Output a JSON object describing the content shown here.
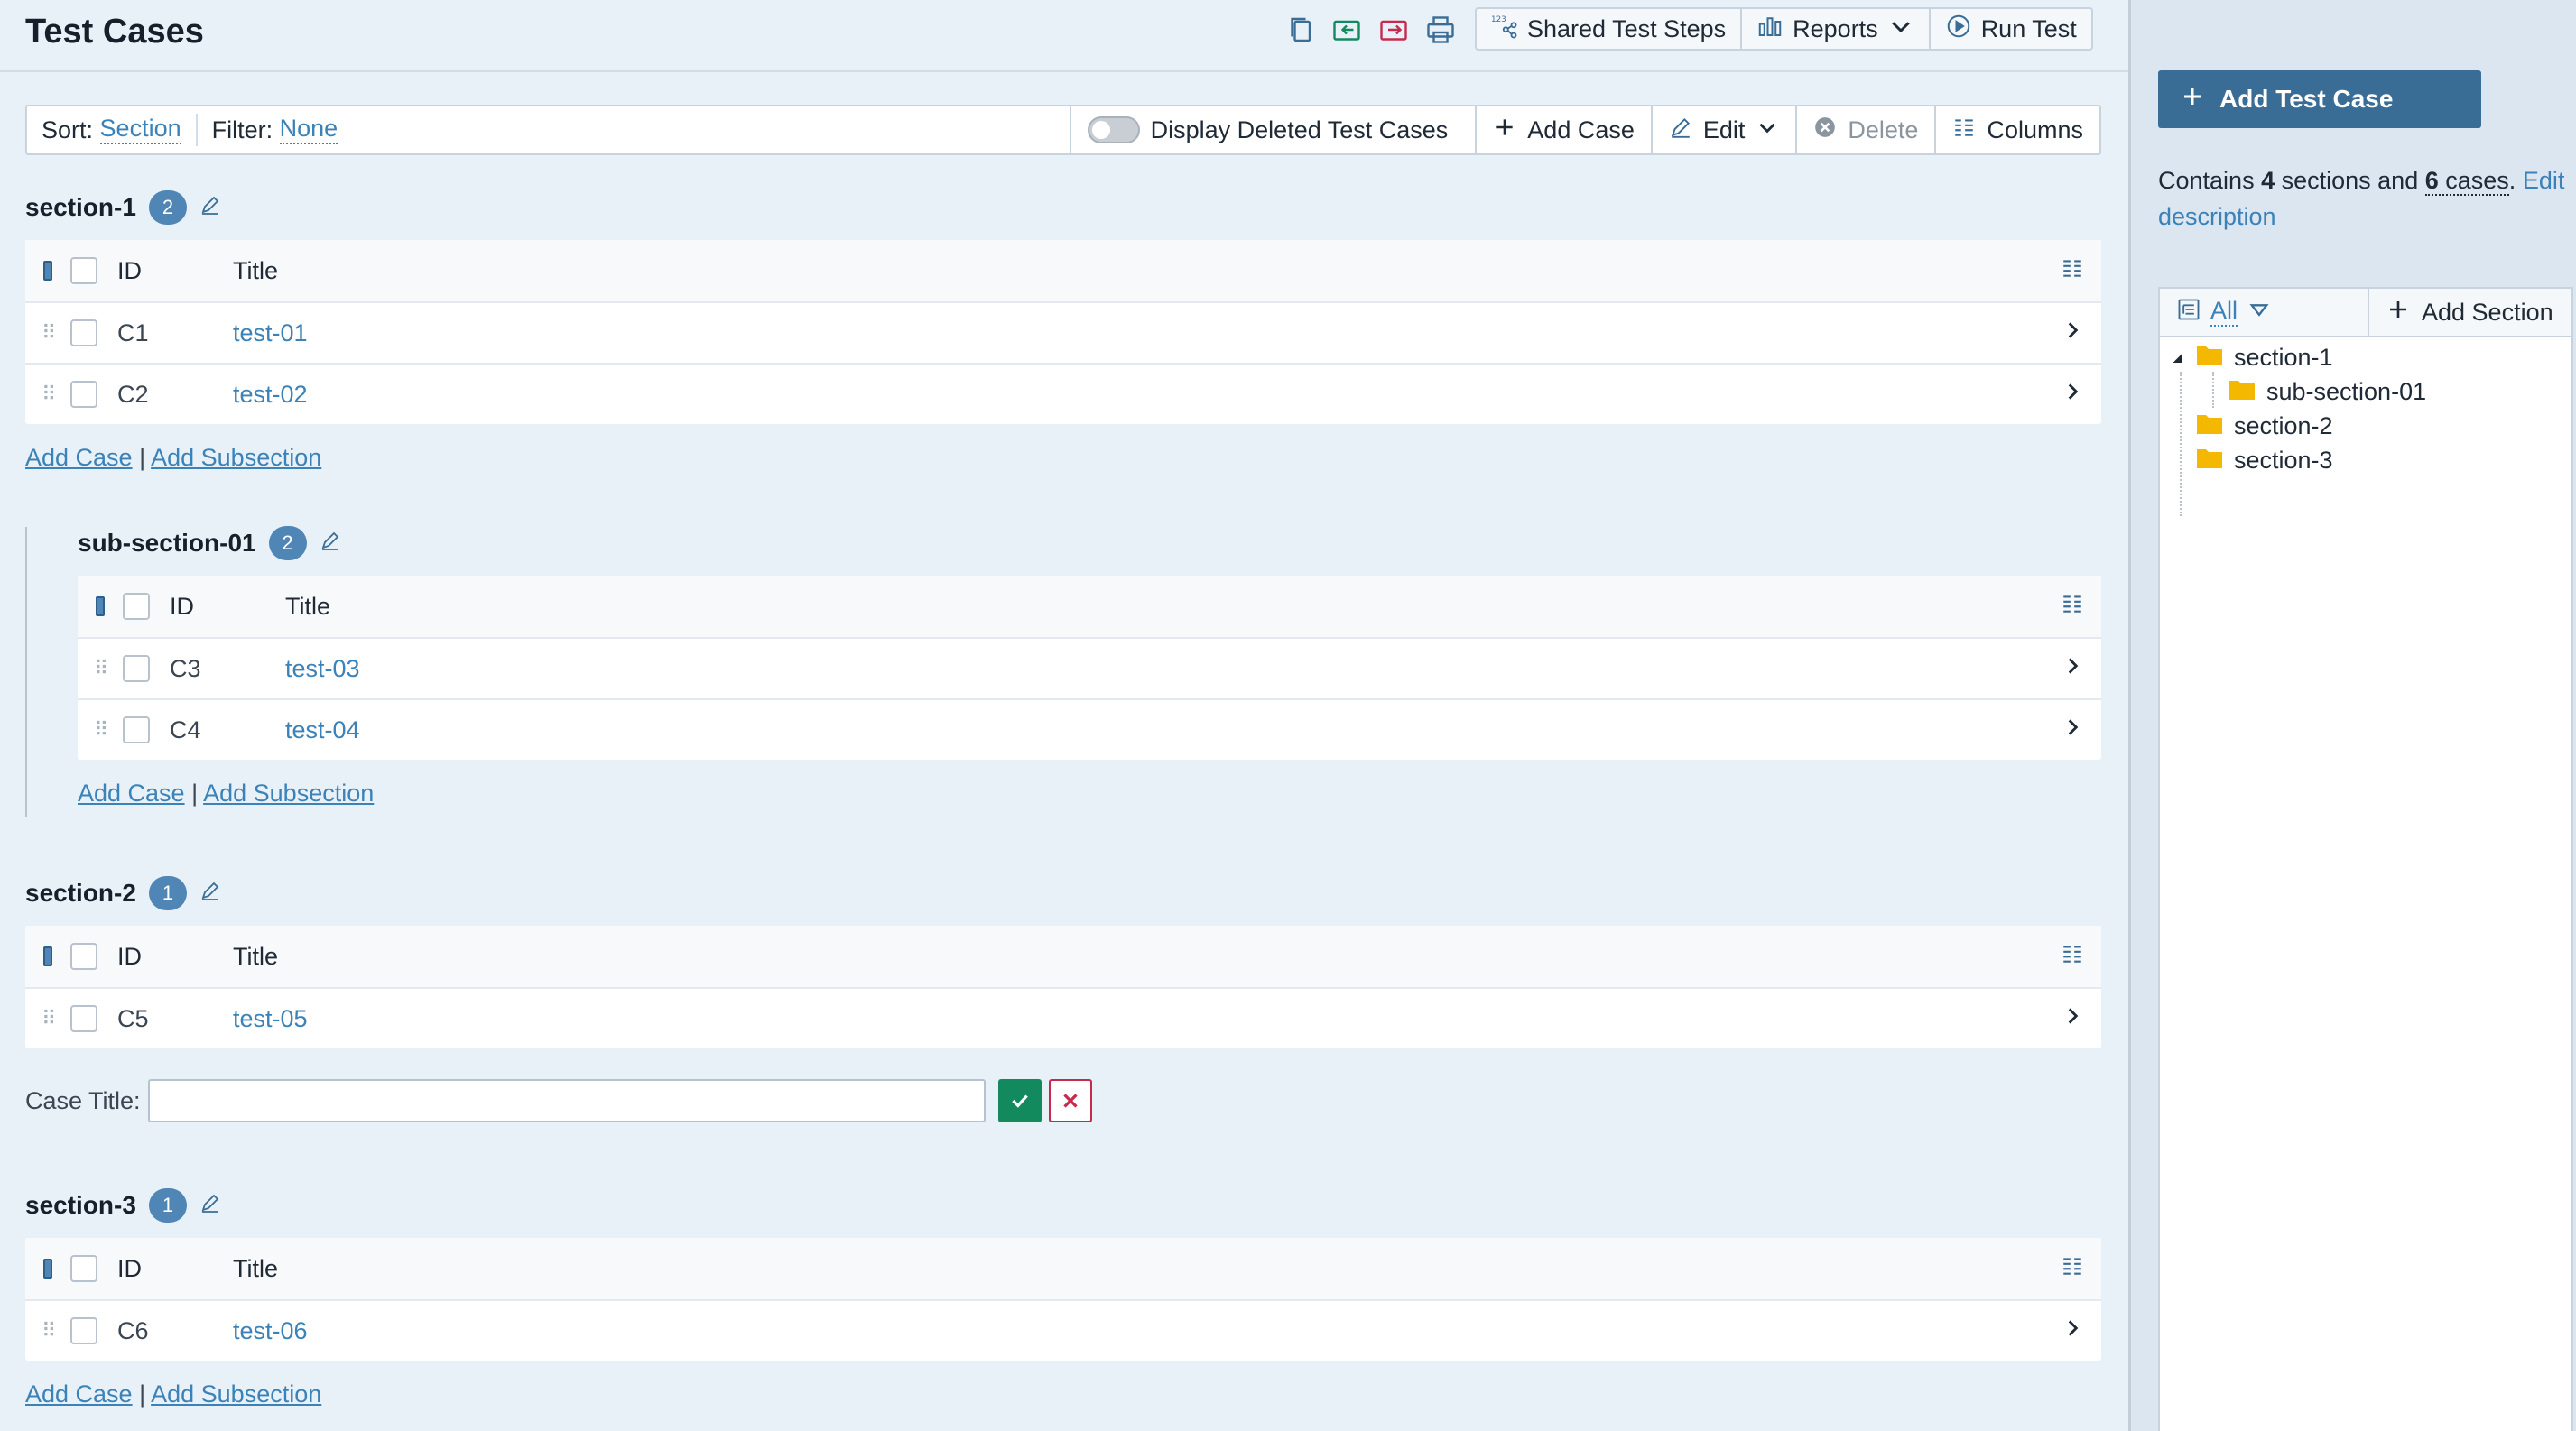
{
  "header": {
    "title": "Test Cases",
    "buttons": {
      "shared_steps": "Shared Test Steps",
      "reports": "Reports",
      "run_test": "Run Test"
    },
    "icons": [
      "copy-icon",
      "import-icon",
      "export-icon",
      "print-icon"
    ]
  },
  "toolbar": {
    "sort_label": "Sort:",
    "sort_value": "Section",
    "filter_label": "Filter:",
    "filter_value": "None",
    "display_deleted": "Display Deleted Test Cases",
    "add_case": "Add Case",
    "edit": "Edit",
    "delete": "Delete",
    "columns": "Columns"
  },
  "table_headers": {
    "id": "ID",
    "title": "Title"
  },
  "sections": [
    {
      "name": "section-1",
      "count": "2",
      "cases": [
        {
          "id": "C1",
          "title": "test-01"
        },
        {
          "id": "C2",
          "title": "test-02"
        }
      ],
      "add_case": "Add Case",
      "add_subsection": "Add Subsection"
    },
    {
      "name": "sub-section-01",
      "count": "2",
      "cases": [
        {
          "id": "C3",
          "title": "test-03"
        },
        {
          "id": "C4",
          "title": "test-04"
        }
      ],
      "add_case": "Add Case",
      "add_subsection": "Add Subsection"
    },
    {
      "name": "section-2",
      "count": "1",
      "cases": [
        {
          "id": "C5",
          "title": "test-05"
        }
      ]
    },
    {
      "name": "section-3",
      "count": "1",
      "cases": [
        {
          "id": "C6",
          "title": "test-06"
        }
      ],
      "add_case": "Add Case",
      "add_subsection": "Add Subsection"
    }
  ],
  "case_title_form": {
    "label": "Case Title:",
    "value": ""
  },
  "sidebar": {
    "add_test_case": "Add Test Case",
    "summary": {
      "prefix": "Contains ",
      "sections": "4",
      "middle": " sections and ",
      "cases": "6",
      "cases_word": " cases",
      "period": ".",
      "edit_description": "Edit description"
    },
    "tree_filter": "All",
    "add_section": "Add Section",
    "tree": [
      "section-1",
      "sub-section-01",
      "section-2",
      "section-3"
    ]
  },
  "colors": {
    "accent": "#3a82b8",
    "badge": "#4f86b5",
    "primary_button": "#3a6d96",
    "ok": "#138a5e",
    "cancel": "#c72a4c"
  }
}
